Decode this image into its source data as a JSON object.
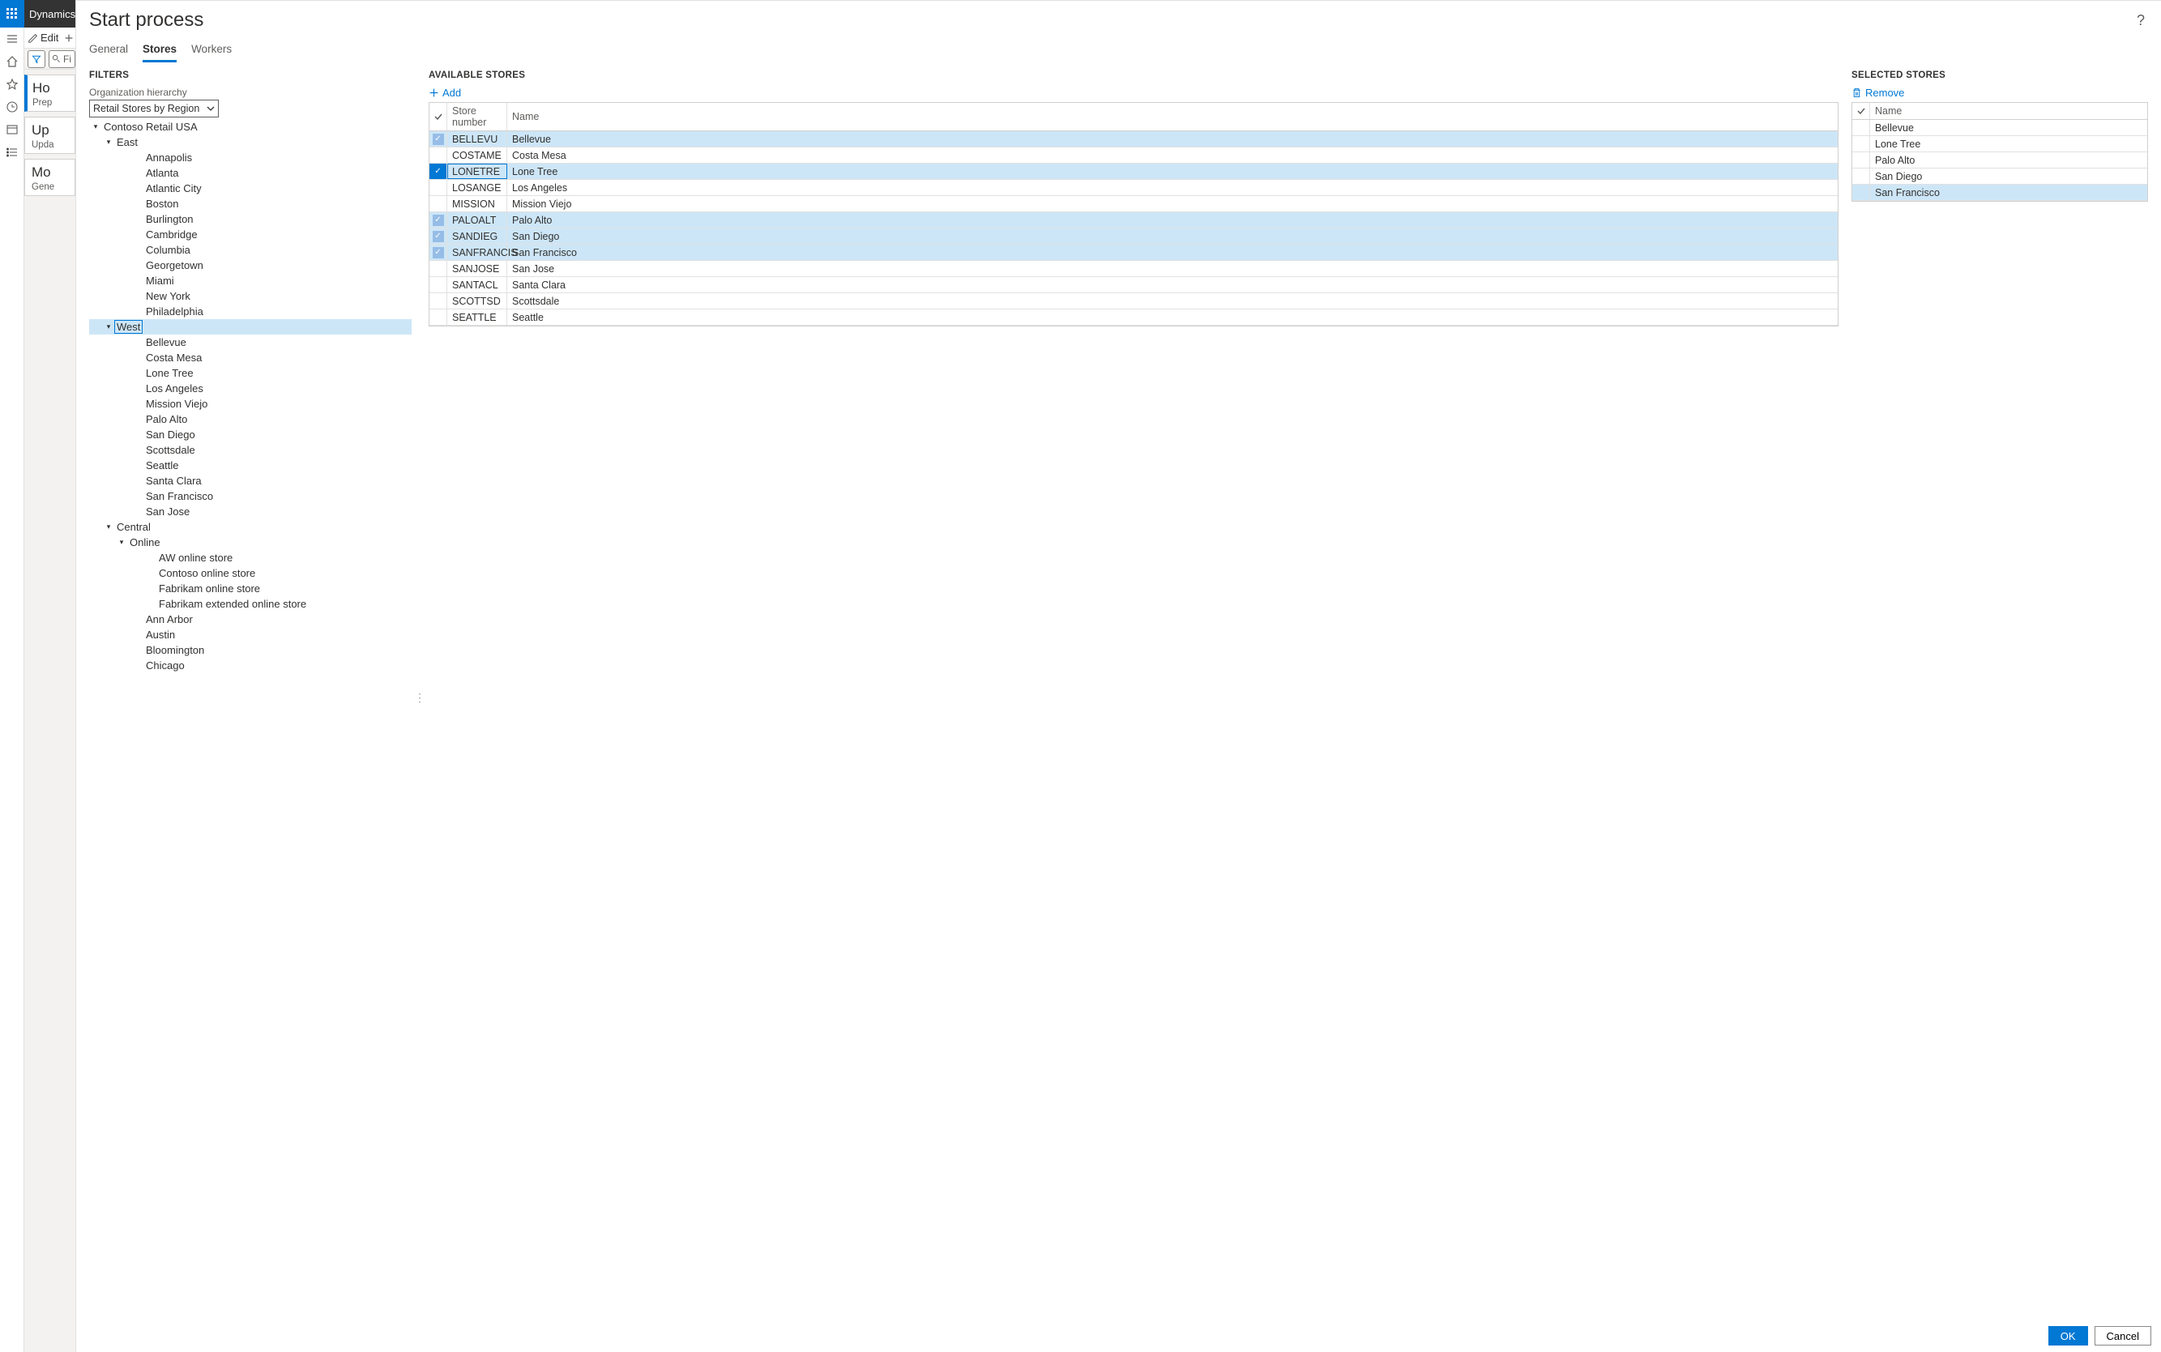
{
  "app": {
    "name": "Dynamics"
  },
  "back_panel": {
    "edit_label": "Edit",
    "filter_placeholder": "Fi",
    "cards": [
      {
        "title": "Ho",
        "sub": "Prep"
      },
      {
        "title": "Up",
        "sub": "Upda"
      },
      {
        "title": "Mo",
        "sub": "Gene"
      }
    ]
  },
  "dialog": {
    "title": "Start process",
    "tabs": {
      "general": "General",
      "stores": "Stores",
      "workers": "Workers",
      "active": "stores"
    },
    "filters": {
      "section_label": "FILTERS",
      "hierarchy_label": "Organization hierarchy",
      "hierarchy_value": "Retail Stores by Region"
    },
    "tree": [
      {
        "level": 1,
        "caret": "down",
        "label": "Contoso Retail USA"
      },
      {
        "level": 2,
        "caret": "down",
        "label": "East"
      },
      {
        "level": 3,
        "label": "Annapolis"
      },
      {
        "level": 3,
        "label": "Atlanta"
      },
      {
        "level": 3,
        "label": "Atlantic City"
      },
      {
        "level": 3,
        "label": "Boston"
      },
      {
        "level": 3,
        "label": "Burlington"
      },
      {
        "level": 3,
        "label": "Cambridge"
      },
      {
        "level": 3,
        "label": "Columbia"
      },
      {
        "level": 3,
        "label": "Georgetown"
      },
      {
        "level": 3,
        "label": "Miami"
      },
      {
        "level": 3,
        "label": "New York"
      },
      {
        "level": 3,
        "label": "Philadelphia"
      },
      {
        "level": 2,
        "caret": "down",
        "label": "West",
        "selected": true
      },
      {
        "level": 3,
        "label": "Bellevue"
      },
      {
        "level": 3,
        "label": "Costa Mesa"
      },
      {
        "level": 3,
        "label": "Lone Tree"
      },
      {
        "level": 3,
        "label": "Los Angeles"
      },
      {
        "level": 3,
        "label": "Mission Viejo"
      },
      {
        "level": 3,
        "label": "Palo Alto"
      },
      {
        "level": 3,
        "label": "San Diego"
      },
      {
        "level": 3,
        "label": "Scottsdale"
      },
      {
        "level": 3,
        "label": "Seattle"
      },
      {
        "level": 3,
        "label": "Santa Clara"
      },
      {
        "level": 3,
        "label": "San Francisco"
      },
      {
        "level": 3,
        "label": "San Jose"
      },
      {
        "level": 2,
        "caret": "down",
        "label": "Central"
      },
      {
        "level": 3,
        "caret": "down",
        "label": "Online"
      },
      {
        "level": 4,
        "label": "AW online store"
      },
      {
        "level": 4,
        "label": "Contoso online store"
      },
      {
        "level": 4,
        "label": "Fabrikam online store"
      },
      {
        "level": 4,
        "label": "Fabrikam extended online store"
      },
      {
        "level": 3,
        "label": "Ann Arbor"
      },
      {
        "level": 3,
        "label": "Austin"
      },
      {
        "level": 3,
        "label": "Bloomington"
      },
      {
        "level": 3,
        "label": "Chicago"
      }
    ],
    "available": {
      "section_label": "AVAILABLE STORES",
      "add_label": "Add",
      "cols": {
        "num": "Store number",
        "name": "Name"
      },
      "rows": [
        {
          "num": "BELLEVU",
          "name": "Bellevue",
          "state": "soft"
        },
        {
          "num": "COSTAME",
          "name": "Costa Mesa",
          "state": ""
        },
        {
          "num": "LONETRE",
          "name": "Lone Tree",
          "state": "hard"
        },
        {
          "num": "LOSANGE",
          "name": "Los Angeles",
          "state": ""
        },
        {
          "num": "MISSION",
          "name": "Mission Viejo",
          "state": ""
        },
        {
          "num": "PALOALT",
          "name": "Palo Alto",
          "state": "soft"
        },
        {
          "num": "SANDIEG",
          "name": "San Diego",
          "state": "soft"
        },
        {
          "num": "SANFRANCIS",
          "name": "San Francisco",
          "state": "soft"
        },
        {
          "num": "SANJOSE",
          "name": "San Jose",
          "state": ""
        },
        {
          "num": "SANTACL",
          "name": "Santa Clara",
          "state": ""
        },
        {
          "num": "SCOTTSD",
          "name": "Scottsdale",
          "state": ""
        },
        {
          "num": "SEATTLE",
          "name": "Seattle",
          "state": ""
        }
      ]
    },
    "selected": {
      "section_label": "SELECTED STORES",
      "remove_label": "Remove",
      "col_name": "Name",
      "rows": [
        {
          "name": "Bellevue"
        },
        {
          "name": "Lone Tree"
        },
        {
          "name": "Palo Alto"
        },
        {
          "name": "San Diego"
        },
        {
          "name": "San Francisco",
          "highlight": true
        }
      ]
    },
    "footer": {
      "ok": "OK",
      "cancel": "Cancel"
    }
  }
}
